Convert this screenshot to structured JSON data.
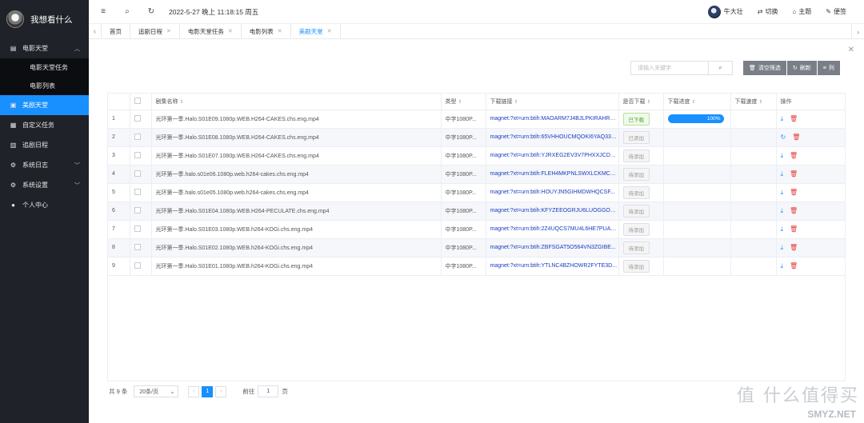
{
  "app": {
    "title": "我想看什么"
  },
  "sidebar": {
    "items": [
      {
        "label": "电影天堂",
        "icon": "film-icon",
        "chevron": "˄"
      },
      {
        "label": "电影天堂任务"
      },
      {
        "label": "电影列表"
      },
      {
        "label": "美剧天堂",
        "icon": "tv-icon",
        "active": true
      },
      {
        "label": "自定义任务",
        "icon": "task-icon"
      },
      {
        "label": "追剧日程",
        "icon": "calendar-icon"
      },
      {
        "label": "系统日志",
        "icon": "gear-icon",
        "chevron": "˅"
      },
      {
        "label": "系统设置",
        "icon": "gear-icon",
        "chevron": "˅"
      },
      {
        "label": "个人中心",
        "icon": "user-icon"
      }
    ]
  },
  "topbar": {
    "datetime": "2022-5-27 晚上 11:18:15 周五",
    "username": "牛大壮",
    "switch_label": "切换",
    "theme_label": "主题",
    "note_label": "便签"
  },
  "tabs": [
    {
      "label": "首页",
      "closable": false
    },
    {
      "label": "追剧日程",
      "closable": true
    },
    {
      "label": "电影天堂任务",
      "closable": true
    },
    {
      "label": "电影列表",
      "closable": true
    },
    {
      "label": "美剧天堂",
      "closable": true,
      "active": true
    }
  ],
  "toolbar": {
    "search_placeholder": "请输入关键字",
    "clear_label": "清空筛选",
    "refresh_label": "刷新",
    "columns_label": "列"
  },
  "table": {
    "headers": [
      "剧集名称",
      "类型",
      "下载链接",
      "是否下载",
      "下载进度",
      "下载速度",
      "操作"
    ],
    "rows": [
      {
        "no": "1",
        "name": "光环第一季.Halo.S01E09.1080p.WEB.H264-CAKES.chs.eng.mp4",
        "type": "中字1080P...",
        "link": "magnet:?xt=urn:btih:MAOARM7J4BJLPKIRAHRQ...",
        "state": "已下载",
        "state_kind": "done",
        "progress": "100%",
        "op_icon": "download-icon"
      },
      {
        "no": "2",
        "name": "光环第一季.Halo.S01E08.1080p.WEB.H264-CAKES.chs.eng.mp4",
        "type": "中字1080P...",
        "link": "magnet:?xt=urn:btih:65VHHOUCMQOKI6YAQ332...",
        "state": "已添加",
        "state_kind": "added",
        "progress": "",
        "op_icon": "refresh-icon"
      },
      {
        "no": "3",
        "name": "光环第一季.Halo.S01E07.1080p.WEB.H264-CAKES.chs.eng.mp4",
        "type": "中字1080P...",
        "link": "magnet:?xt=urn:btih:YJRXEG2EV3V7PHXXJCD5...",
        "state": "待添加",
        "state_kind": "pending",
        "progress": "",
        "op_icon": "download-icon"
      },
      {
        "no": "4",
        "name": "光环第一季.halo.s01e06.1080p.web.h264-cakes.chs.eng.mp4",
        "type": "中字1080P...",
        "link": "magnet:?xt=urn:btih:FLEH4MKPNLSWXLCKMCN...",
        "state": "待添加",
        "state_kind": "pending",
        "progress": "",
        "op_icon": "download-icon"
      },
      {
        "no": "5",
        "name": "光环第一季.halo.s01e05.1080p.web.h264-cakes.chs.eng.mp4",
        "type": "中字1080P...",
        "link": "magnet:?xt=urn:btih:HOUYJN5GIHMDWHQCSF...",
        "state": "待添加",
        "state_kind": "pending",
        "progress": "",
        "op_icon": "download-icon"
      },
      {
        "no": "6",
        "name": "光环第一季.Halo.S01E04.1080p.WEB.H264-PECULATE.chs.eng.mp4",
        "type": "中字1080P...",
        "link": "magnet:?xt=urn:btih:KFYZEEOGRJU6LUOGGOD...",
        "state": "待添加",
        "state_kind": "pending",
        "progress": "",
        "op_icon": "download-icon"
      },
      {
        "no": "7",
        "name": "光环第一季.Halo.S01E03.1080p.WEB.h264-KOGi.chs.eng.mp4",
        "type": "中字1080P...",
        "link": "magnet:?xt=urn:btih:2Z4UQCS7MU4L6HE7PUAS...",
        "state": "待添加",
        "state_kind": "pending",
        "progress": "",
        "op_icon": "download-icon"
      },
      {
        "no": "8",
        "name": "光环第一季.Halo.S01E02.1080p.WEB.h264-KOGi.chs.eng.mp4",
        "type": "中字1080P...",
        "link": "magnet:?xt=urn:btih:ZBFSGAT5O564VN3ZGIBE...",
        "state": "待添加",
        "state_kind": "pending",
        "progress": "",
        "op_icon": "download-icon"
      },
      {
        "no": "9",
        "name": "光环第一季.Halo.S01E01.1080p.WEB.h264-KOGi.chs.eng.mp4",
        "type": "中字1080P...",
        "link": "magnet:?xt=urn:btih:YTLNC4BZHOWR2FYTE3D...",
        "state": "待添加",
        "state_kind": "pending",
        "progress": "",
        "op_icon": "download-icon"
      }
    ]
  },
  "pager": {
    "total": "共 9 条",
    "page_size": "20条/页",
    "current_page": "1",
    "goto_label": "前往",
    "goto_value": "1",
    "page_suffix": "页"
  },
  "watermark": {
    "big": "值 什么值得买",
    "small": "SMYZ.NET"
  },
  "colors": {
    "accent": "#1890ff",
    "sidebar_bg": "#1f2228",
    "danger": "#e53935"
  }
}
